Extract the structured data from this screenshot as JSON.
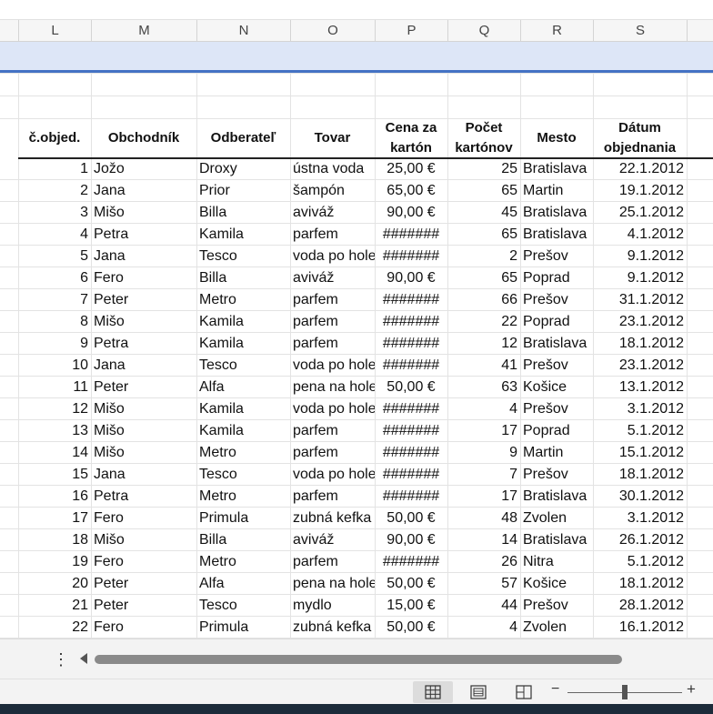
{
  "columns": [
    "L",
    "M",
    "N",
    "O",
    "P",
    "Q",
    "R",
    "S"
  ],
  "headers": {
    "obj": "č.objed.",
    "obchodnik": "Obchodník",
    "odberatel": "Odberateľ",
    "tovar": "Tovar",
    "cena_1": "Cena za",
    "cena_2": "kartón",
    "pocet_1": "Počet",
    "pocet_2": "kartónov",
    "mesto": "Mesto",
    "datum_1": "Dátum",
    "datum_2": "objednania"
  },
  "rows": [
    [
      "1",
      "Jožo",
      "Droxy",
      "ústna voda",
      "25,00 €",
      "25",
      "Bratislava",
      "22.1.2012"
    ],
    [
      "2",
      "Jana",
      "Prior",
      "šampón",
      "65,00 €",
      "65",
      "Martin",
      "19.1.2012"
    ],
    [
      "3",
      "Mišo",
      "Billa",
      "aviváž",
      "90,00 €",
      "45",
      "Bratislava",
      "25.1.2012"
    ],
    [
      "4",
      "Petra",
      "Kamila",
      "parfem",
      "#######",
      "65",
      "Bratislava",
      "4.1.2012"
    ],
    [
      "5",
      "Jana",
      "Tesco",
      "voda po holení",
      "#######",
      "2",
      "Prešov",
      "9.1.2012"
    ],
    [
      "6",
      "Fero",
      "Billa",
      "aviváž",
      "90,00 €",
      "65",
      "Poprad",
      "9.1.2012"
    ],
    [
      "7",
      "Peter",
      "Metro",
      "parfem",
      "#######",
      "66",
      "Prešov",
      "31.1.2012"
    ],
    [
      "8",
      "Mišo",
      "Kamila",
      "parfem",
      "#######",
      "22",
      "Poprad",
      "23.1.2012"
    ],
    [
      "9",
      "Petra",
      "Kamila",
      "parfem",
      "#######",
      "12",
      "Bratislava",
      "18.1.2012"
    ],
    [
      "10",
      "Jana",
      "Tesco",
      "voda po holení",
      "#######",
      "41",
      "Prešov",
      "23.1.2012"
    ],
    [
      "11",
      "Peter",
      "Alfa",
      "pena na holenie",
      "50,00 €",
      "63",
      "Košice",
      "13.1.2012"
    ],
    [
      "12",
      "Mišo",
      "Kamila",
      "voda po holení",
      "#######",
      "4",
      "Prešov",
      "3.1.2012"
    ],
    [
      "13",
      "Mišo",
      "Kamila",
      "parfem",
      "#######",
      "17",
      "Poprad",
      "5.1.2012"
    ],
    [
      "14",
      "Mišo",
      "Metro",
      "parfem",
      "#######",
      "9",
      "Martin",
      "15.1.2012"
    ],
    [
      "15",
      "Jana",
      "Tesco",
      "voda po holení",
      "#######",
      "7",
      "Prešov",
      "18.1.2012"
    ],
    [
      "16",
      "Petra",
      "Metro",
      "parfem",
      "#######",
      "17",
      "Bratislava",
      "30.1.2012"
    ],
    [
      "17",
      "Fero",
      "Primula",
      "zubná kefka",
      "50,00 €",
      "48",
      "Zvolen",
      "3.1.2012"
    ],
    [
      "18",
      "Mišo",
      "Billa",
      "aviváž",
      "90,00 €",
      "14",
      "Bratislava",
      "26.1.2012"
    ],
    [
      "19",
      "Fero",
      "Metro",
      "parfem",
      "#######",
      "26",
      "Nitra",
      "5.1.2012"
    ],
    [
      "20",
      "Peter",
      "Alfa",
      "pena na holenie",
      "50,00 €",
      "57",
      "Košice",
      "18.1.2012"
    ],
    [
      "21",
      "Peter",
      "Tesco",
      "mydlo",
      "15,00 €",
      "44",
      "Prešov",
      "28.1.2012"
    ],
    [
      "22",
      "Fero",
      "Primula",
      "zubná kefka",
      "50,00 €",
      "4",
      "Zvolen",
      "16.1.2012"
    ]
  ],
  "icons": {
    "menu": "vertical-dots-icon",
    "scroll_left": "triangle-left-icon",
    "normal_view": "grid-view-icon",
    "page_layout": "page-layout-icon",
    "page_break": "page-break-icon"
  },
  "zoom": {
    "minus": "−",
    "plus": "+"
  },
  "menu_glyph": "⋮",
  "colors": {
    "header_band": "#dde6f7",
    "header_band_border": "#4472c4"
  }
}
